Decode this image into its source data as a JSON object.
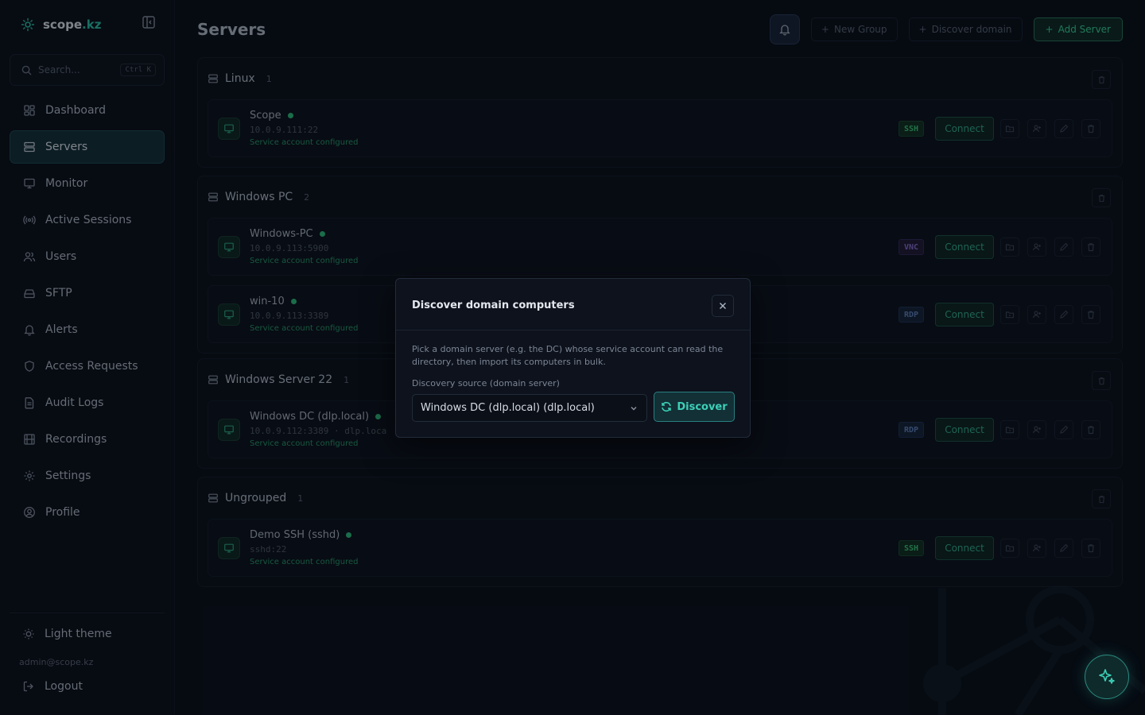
{
  "app": {
    "brand_name": "scope",
    "brand_suffix": ".kz",
    "accent_color": "#2fc4aa"
  },
  "search": {
    "placeholder": "Search...",
    "shortcut": "Ctrl K"
  },
  "nav": {
    "items": [
      {
        "label": "Dashboard",
        "icon": "dashboard-icon",
        "active": false
      },
      {
        "label": "Servers",
        "icon": "server-icon",
        "active": true
      },
      {
        "label": "Monitor",
        "icon": "monitor-icon",
        "active": false
      },
      {
        "label": "Active Sessions",
        "icon": "broadcast-icon",
        "active": false
      },
      {
        "label": "Users",
        "icon": "users-icon",
        "active": false
      },
      {
        "label": "SFTP",
        "icon": "drive-icon",
        "active": false
      },
      {
        "label": "Alerts",
        "icon": "bell-icon",
        "active": false
      },
      {
        "label": "Access Requests",
        "icon": "shield-icon",
        "active": false
      },
      {
        "label": "Audit Logs",
        "icon": "document-icon",
        "active": false
      },
      {
        "label": "Recordings",
        "icon": "film-icon",
        "active": false
      },
      {
        "label": "Settings",
        "icon": "gear-icon",
        "active": false
      },
      {
        "label": "Profile",
        "icon": "user-circle-icon",
        "active": false
      }
    ]
  },
  "sidebar_footer": {
    "theme_label": "Light theme",
    "user_email": "admin@scope.kz",
    "logout_label": "Logout"
  },
  "header": {
    "title": "Servers",
    "new_group_label": "New Group",
    "discover_domain_label": "Discover domain",
    "add_server_label": "Add Server"
  },
  "row_actions": {
    "connect_label": "Connect"
  },
  "groups": [
    {
      "name": "Linux",
      "count": "1",
      "servers": [
        {
          "name": "Scope",
          "address": "10.0.9.111:22",
          "status": "Service account configured",
          "protocol": "SSH"
        }
      ]
    },
    {
      "name": "Windows PC",
      "count": "2",
      "servers": [
        {
          "name": "Windows-PC",
          "address": "10.0.9.113:5900",
          "status": "Service account configured",
          "protocol": "VNC"
        },
        {
          "name": "win-10",
          "address": "10.0.9.113:3389",
          "status": "Service account configured",
          "protocol": "RDP"
        }
      ]
    },
    {
      "name": "Windows Server 22",
      "count": "1",
      "servers": [
        {
          "name": "Windows DC (dlp.local)",
          "address": "10.0.9.112:3389 · dlp.loca",
          "status": "Service account configured",
          "protocol": "RDP"
        }
      ]
    },
    {
      "name": "Ungrouped",
      "count": "1",
      "servers": [
        {
          "name": "Demo SSH (sshd)",
          "address": "sshd:22",
          "status": "Service account configured",
          "protocol": "SSH"
        }
      ]
    }
  ],
  "modal": {
    "title": "Discover domain computers",
    "description": "Pick a domain server (e.g. the DC) whose service account can read the directory, then import its computers in bulk.",
    "field_label": "Discovery source (domain server)",
    "selected_source": "Windows DC (dlp.local) (dlp.local)",
    "discover_label": "Discover"
  }
}
